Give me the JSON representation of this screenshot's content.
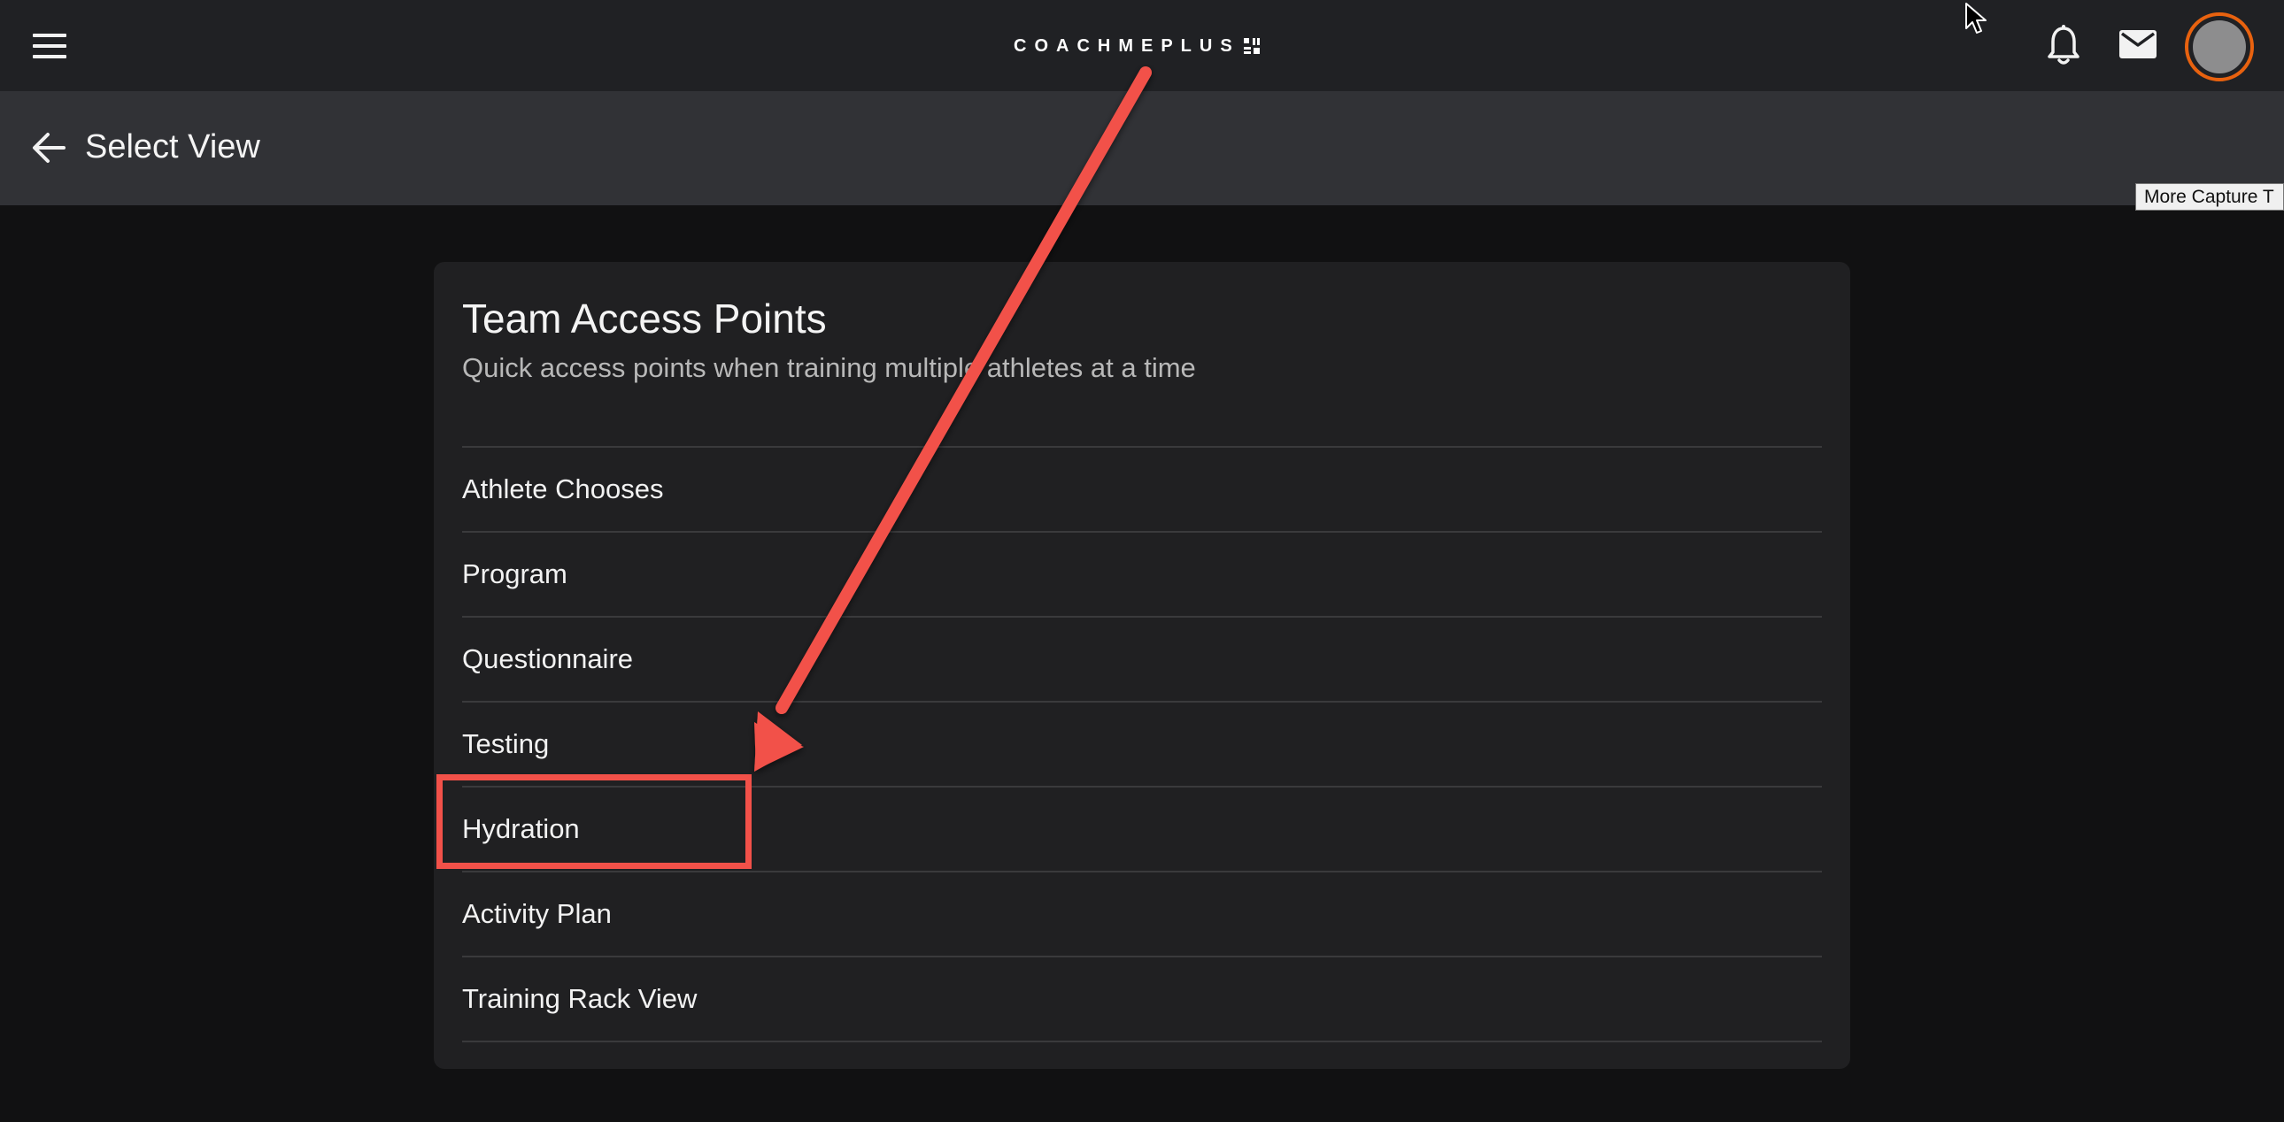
{
  "topbar": {
    "logo_text": "COACHMEPLUS",
    "avatar_ring_color": "#e8620f",
    "icons": [
      "menu-icon",
      "bell-icon",
      "mail-icon",
      "avatar"
    ]
  },
  "header": {
    "title": "Select View"
  },
  "tooltip": {
    "text": "More Capture T"
  },
  "card": {
    "title": "Team Access Points",
    "subtitle": "Quick access points when training multiple athletes at a time",
    "items": [
      {
        "label": "Athlete Chooses"
      },
      {
        "label": "Program"
      },
      {
        "label": "Questionnaire"
      },
      {
        "label": "Testing"
      },
      {
        "label": "Hydration"
      },
      {
        "label": "Activity Plan"
      },
      {
        "label": "Training Rack View"
      }
    ]
  },
  "annotation": {
    "color": "#f25149",
    "highlighted_item": "Hydration"
  }
}
